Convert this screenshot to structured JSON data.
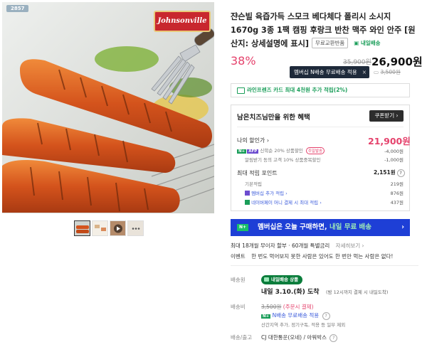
{
  "image": {
    "badge": "2857",
    "brand_logo": "Johnsonville"
  },
  "thumbnails": [
    "thumb-1",
    "thumb-2",
    "thumb-3",
    "thumb-4"
  ],
  "product": {
    "title": "쟌슨빌 육즙가득 스모크 베다체다 폴리시 소시지 1670g 3종 1팩 캠핑 후랑크 반찬 맥주 와인 안주 [원산지: 상세설명에 표시]",
    "return_chip": "무료교환반품",
    "delivery_chip": "내일배송"
  },
  "price": {
    "discount": "38%",
    "original": "35,900원",
    "sale": "26,900원",
    "tooltip": "멤버십 N배송 무료배송 적용",
    "tooltip_close": "×",
    "shipping_fee_strike": "3,500원"
  },
  "card_banner": "라인프렌즈 카드 최대 4천원 추가 적립(2%)",
  "benefits": {
    "title": "남은치즈님만을 위한 혜택",
    "coupon_button": "쿠폰받기 ›",
    "my_price_label": "나의 할인가 ›",
    "my_price_value": "21,900원",
    "npay_tag": "N+",
    "afp_tag": "AFP",
    "line1_text": "신학순 20% 상품할인",
    "line1_chip": "주일발송",
    "line1_value": "-4,000원",
    "line2_text": "알림받기 동의 고객 10% 상품중복할인",
    "line2_value": "-1,000원",
    "points_label": "최대 적립 포인트",
    "points_value": "2,151원",
    "points_rows": [
      {
        "label": "기본적립",
        "value": "219원"
      },
      {
        "label": "멤버십 추가 적립 ›",
        "value": "876원"
      },
      {
        "label": "네이버페이 머니 결제 시 최대 적립 ›",
        "value": "437원"
      }
    ]
  },
  "member_banner": {
    "tag": "N+",
    "text_main": "멤버십은 오늘 구매하면,",
    "text_hl": "내일 무료 배송",
    "arrow": "›"
  },
  "installment": {
    "text": "최대 18개월 무이자 할부 · 60개월 특별금리",
    "link": "자세히보기 ›"
  },
  "event": {
    "label": "이벤트",
    "text": "한 번도 먹어보지 못한 사람은 있어도 한 번만 먹는 사람은 없다!"
  },
  "shipping": {
    "method_label": "배송원",
    "badge": "내일배송 상품",
    "date": "내일 3.10.(화) 도착",
    "date_note": "밤 12시까지 결제 시 내일도착",
    "fee_label": "배송비",
    "fee_strike": "3,500원",
    "fee_note": "(주문시 결제)",
    "fee_member_text": "N배송 무료배송 적용",
    "fee_sub": "산간지역 추가, 정기구독, 적용 등 일부 제외",
    "courier_label": "배송/출고",
    "courier": "CJ 대한통운(오네) / 아워박스"
  },
  "colors": {
    "accent_red": "#e5426c",
    "naver_green": "#1b9e5a",
    "member_blue": "#1e3fd6"
  }
}
